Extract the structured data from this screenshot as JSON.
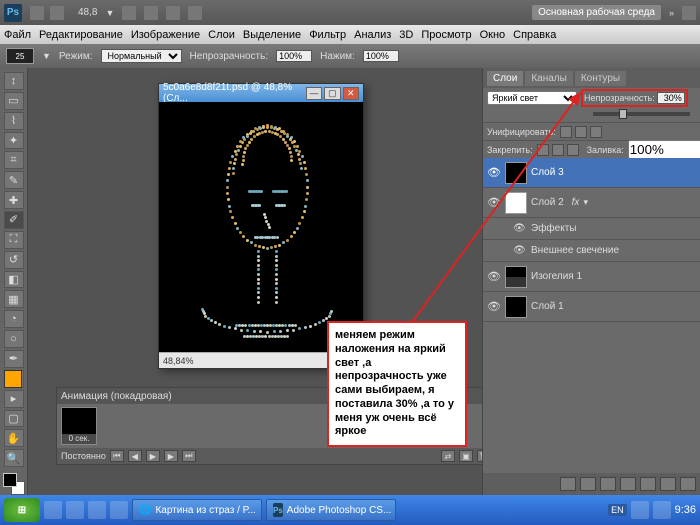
{
  "topbar": {
    "logo_text": "Ps",
    "zoom_value": "48,8",
    "workspace_label": "Основная рабочая среда"
  },
  "menu": {
    "items": [
      "Файл",
      "Редактирование",
      "Изображение",
      "Слои",
      "Выделение",
      "Фильтр",
      "Анализ",
      "3D",
      "Просмотр",
      "Окно",
      "Справка"
    ]
  },
  "options": {
    "brush_size": "25",
    "mode_label": "Режим:",
    "mode_value": "Нормальный",
    "opacity_label": "Непрозрачность:",
    "opacity_value": "100%",
    "flow_label": "Нажим:",
    "flow_value": "100%"
  },
  "document": {
    "title": "5c0a6e8d8f21t.psd @ 48,8% (Сл...",
    "zoom_status": "48,84%"
  },
  "layers_panel": {
    "tabs": [
      "Слои",
      "Каналы",
      "Контуры"
    ],
    "blend_mode": "Яркий свет",
    "opacity_label": "Непрозрачность:",
    "opacity_value": "30%",
    "unify_label": "Унифицировать:",
    "lock_label": "Закрепить:",
    "fill_label": "Заливка:",
    "fill_value": "100%",
    "layers": [
      {
        "name": "Слой 3",
        "selected": true
      },
      {
        "name": "Слой 2",
        "fx": "fx"
      }
    ],
    "effects_label": "Эффекты",
    "effect_outer_glow": "Внешнее свечение",
    "iso_layer": "Изогелия 1",
    "bg_layer": "Слой 1"
  },
  "animation": {
    "title": "Анимация (покадровая)",
    "frame_time": "0 сек.",
    "loop_label": "Постоянно"
  },
  "callout_text": "меняем режим наложения на яркий свет ,а непрозрачность уже сами выбираем, я поставила 30% ,а то у меня уж очень всё яркое",
  "taskbar": {
    "task1": "Картина из страз / Р...",
    "task2": "Adobe Photoshop CS...",
    "lang": "EN",
    "time": "9:36"
  }
}
